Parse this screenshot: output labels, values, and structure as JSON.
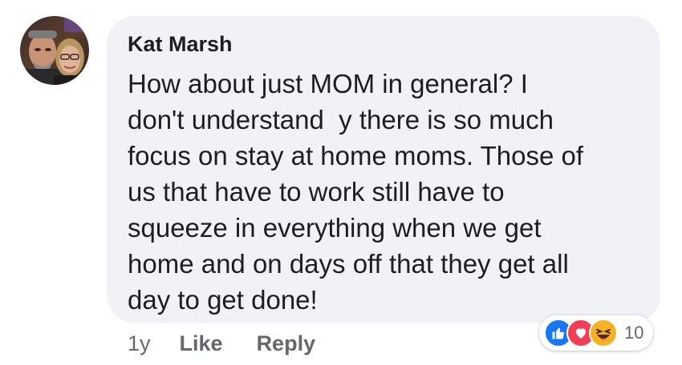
{
  "comment": {
    "author": "Kat Marsh",
    "text_lines": [
      "How about just MOM in general? I",
      "don't understand  y there is so much",
      "focus on stay at home moms. Those of",
      "us that have to work still have to",
      "squeeze in everything when we get",
      "home and on days off that they get all",
      "day to get done!"
    ],
    "timestamp": "1y",
    "like_label": "Like",
    "reply_label": "Reply",
    "reactions": {
      "icons": [
        "like-icon",
        "love-icon",
        "haha-icon"
      ],
      "count": "10"
    }
  },
  "colors": {
    "bubble": "#f0f2f5",
    "like": "#1877f2",
    "love": "#f33e58",
    "haha": "#f7b125",
    "meta_text": "#65676b"
  }
}
